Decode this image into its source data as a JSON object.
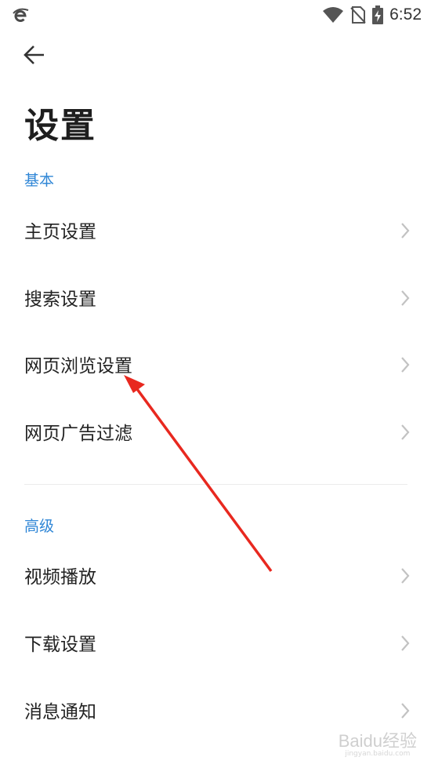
{
  "status_bar": {
    "time": "6:52",
    "app_icon": "browser-e-icon",
    "icons": [
      "wifi-icon",
      "no-sim-icon",
      "battery-charging-icon"
    ]
  },
  "header": {
    "back_icon": "back-arrow-icon",
    "title": "设置"
  },
  "sections": [
    {
      "label": "基本",
      "items": [
        {
          "label": "主页设置"
        },
        {
          "label": "搜索设置"
        },
        {
          "label": "网页浏览设置"
        },
        {
          "label": "网页广告过滤"
        }
      ]
    },
    {
      "label": "高级",
      "items": [
        {
          "label": "视频播放"
        },
        {
          "label": "下载设置"
        },
        {
          "label": "消息通知"
        }
      ]
    }
  ],
  "watermark": {
    "main": "Baidu经验",
    "sub": "jingyan.baidu.com"
  },
  "colors": {
    "accent": "#2f86d6",
    "annotation_arrow": "#e8281f"
  }
}
